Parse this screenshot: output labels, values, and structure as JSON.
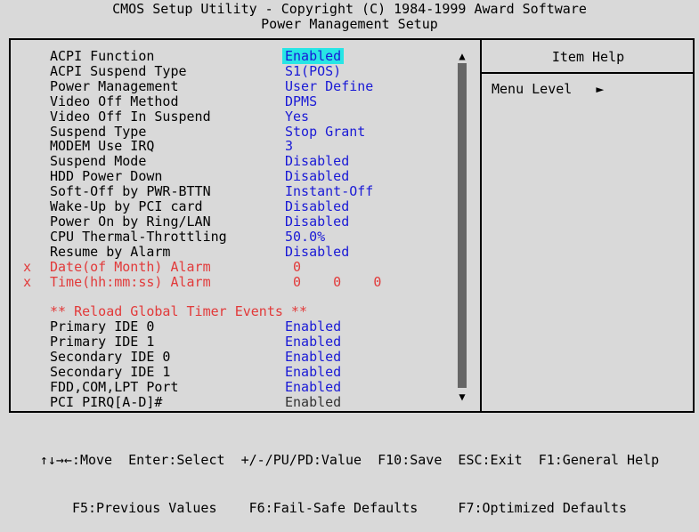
{
  "header": {
    "line1": "CMOS Setup Utility - Copyright (C) 1984-1999 Award Software",
    "line2": "Power Management Setup"
  },
  "settings": [
    {
      "label": "ACPI Function",
      "value": "Enabled",
      "highlighted": true
    },
    {
      "label": "ACPI Suspend Type",
      "value": "S1(POS)"
    },
    {
      "label": "Power Management",
      "value": "User Define"
    },
    {
      "label": "Video Off Method",
      "value": "DPMS"
    },
    {
      "label": "Video Off In Suspend",
      "value": "Yes"
    },
    {
      "label": "Suspend Type",
      "value": "Stop Grant"
    },
    {
      "label": "MODEM Use IRQ",
      "value": "3"
    },
    {
      "label": "Suspend Mode",
      "value": "Disabled"
    },
    {
      "label": "HDD Power Down",
      "value": "Disabled"
    },
    {
      "label": "Soft-Off by PWR-BTTN",
      "value": "Instant-Off"
    },
    {
      "label": "Wake-Up by PCI card",
      "value": "Disabled"
    },
    {
      "label": "Power On by Ring/LAN",
      "value": "Disabled"
    },
    {
      "label": "CPU Thermal-Throttling",
      "value": "50.0%"
    },
    {
      "label": "Resume by Alarm",
      "value": "Disabled"
    },
    {
      "label": "Date(of Month) Alarm",
      "value": " 0",
      "disabled": true,
      "marker": "x"
    },
    {
      "label": "Time(hh:mm:ss) Alarm",
      "value": " 0    0    0",
      "disabled": true,
      "marker": "x"
    },
    {
      "label": "",
      "value": ""
    },
    {
      "label": "** Reload Global Timer Events **",
      "value": "",
      "section": true
    },
    {
      "label": "Primary IDE 0",
      "value": "Enabled"
    },
    {
      "label": "Primary IDE 1",
      "value": "Enabled"
    },
    {
      "label": "Secondary IDE 0",
      "value": "Enabled"
    },
    {
      "label": "Secondary IDE 1",
      "value": "Enabled"
    },
    {
      "label": "FDD,COM,LPT Port",
      "value": "Enabled"
    },
    {
      "label": "PCI PIRQ[A-D]#",
      "value": "Enabled",
      "dim": true
    }
  ],
  "help": {
    "title": "Item Help",
    "menu_level": "Menu Level   ►"
  },
  "scroll": {
    "up": "▲",
    "down": "▼"
  },
  "footer": {
    "line1": "↑↓→←:Move  Enter:Select  +/-/PU/PD:Value  F10:Save  ESC:Exit  F1:General Help",
    "line2": "F5:Previous Values    F6:Fail-Safe Defaults     F7:Optimized Defaults"
  }
}
